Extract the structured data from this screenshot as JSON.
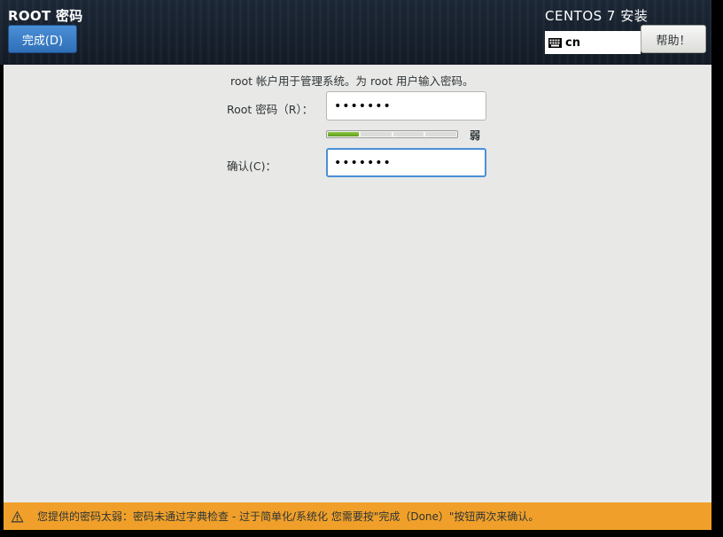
{
  "header": {
    "spoke_title": "ROOT 密码",
    "done_label": "完成(D)",
    "product_title": "CENTOS 7 安装",
    "keyboard_layout": "cn",
    "help_label": "帮助！"
  },
  "form": {
    "description": "root 帐户用于管理系统。为 root 用户输入密码。",
    "password_label": "Root 密码（R）：",
    "password_value": "1234567",
    "confirm_label": "确认(C)：",
    "confirm_value": "1234567",
    "strength": {
      "label": "弱",
      "segments_total": 4,
      "segments_filled": 1,
      "color": "#73b22e"
    }
  },
  "warning": {
    "message": "您提供的密码太弱：密码未通过字典检查 - 过于简单化/系统化 您需要按\"完成（Done）\"按钮两次来确认。",
    "color": "#f0a02a",
    "icon": "warning-triangle-icon"
  }
}
